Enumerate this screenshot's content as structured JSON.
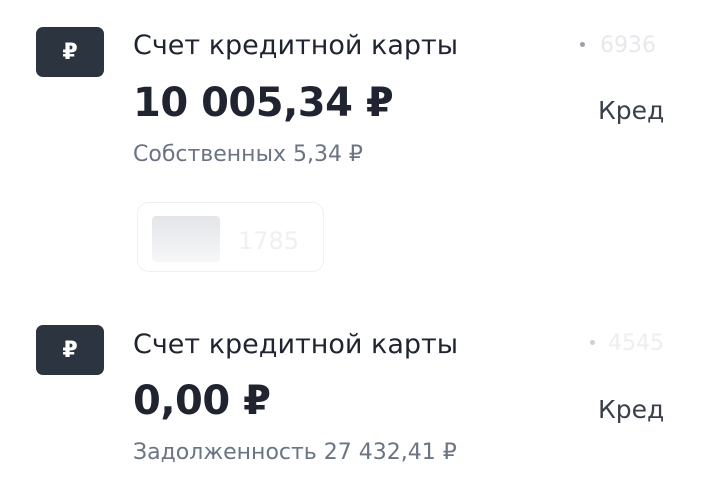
{
  "accounts": [
    {
      "currency_icon": "₽",
      "title": "Счет кредитной карты",
      "amount": "10 005,34 ₽",
      "subtitle": "Собственных 5,34 ₽",
      "right_number": "6936",
      "right_type": "Кред",
      "card": {
        "number": "1785"
      }
    },
    {
      "currency_icon": "₽",
      "title": "Счет кредитной карты",
      "amount": "0,00 ₽",
      "subtitle": "Задолженность 27 432,41 ₽",
      "right_number": "4545",
      "right_type": "Кред"
    }
  ],
  "colors": {
    "badge_bg": "#2c3440",
    "primary_text": "#1f2430",
    "secondary_text": "#6a7483"
  }
}
